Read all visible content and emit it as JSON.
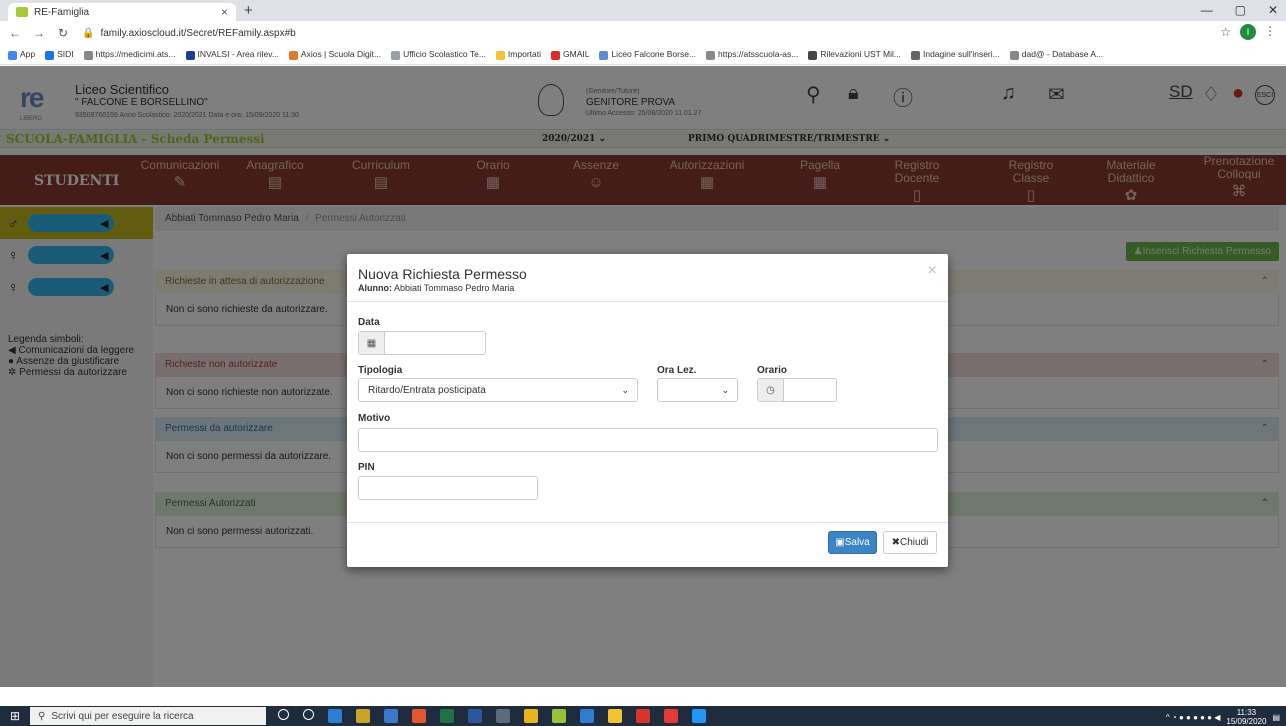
{
  "browser": {
    "tab_title": "RE-Famiglia",
    "tab_close": "×",
    "new_tab": "+",
    "url": "family.axioscloud.it/Secret/REFamily.aspx#b",
    "profile_initial": "I",
    "bookmarks": [
      {
        "label": "App",
        "color": "#4285f4"
      },
      {
        "label": "SIDI",
        "color": "#1a73e8"
      },
      {
        "label": "https://medicimi.ats...",
        "color": "#888"
      },
      {
        "label": "INVALSI - Area rilev...",
        "color": "#1e3f8c"
      },
      {
        "label": "Axios | Scuola Digit...",
        "color": "#e07a2a"
      },
      {
        "label": "Ufficio Scolastico Te...",
        "color": "#9aa0a6"
      },
      {
        "label": "Importati",
        "color": "#f4c430"
      },
      {
        "label": "GMAIL",
        "color": "#d93025"
      },
      {
        "label": "Liceo Falcone Borse...",
        "color": "#5a8fd0"
      },
      {
        "label": "https://atsscuola-as...",
        "color": "#888"
      },
      {
        "label": "Rilevazioni UST Mil...",
        "color": "#444"
      },
      {
        "label": "Indagine sull'inseri...",
        "color": "#666"
      },
      {
        "label": "dad@ - Database A...",
        "color": "#888"
      }
    ]
  },
  "header": {
    "logo": "re",
    "logo_sub": "LIBERO",
    "school_name": "Liceo Scientifico",
    "school_sub": "\" FALCONE E BORSELLINO\"",
    "school_info": "93508760159     Anno Scolastico: 2020/2021   Data e ora: 15/09/2020 11:30",
    "user_role": "(Genitore/Tutore)",
    "user_name": "GENITORE PROVA",
    "last_access": "Ultimo Accesso: 25/08/2020 11.01.27",
    "sd_label": "SD",
    "esci_label": "ESCI"
  },
  "subheader": {
    "title": "SCUOLA-FAMIGLIA - Scheda Permessi",
    "year": "2020/2021 ⌄",
    "period": "PRIMO QUADRIMESTRE/TRIMESTRE   ⌄"
  },
  "menu": {
    "studenti": "STUDENTI",
    "items": [
      {
        "label": "Comunicazioni",
        "icon": "✎"
      },
      {
        "label": "Anagrafico",
        "icon": "▤"
      },
      {
        "label": "Curriculum",
        "icon": "▤"
      },
      {
        "label": "Orario",
        "icon": "▦"
      },
      {
        "label": "Assenze",
        "icon": "☺"
      },
      {
        "label": "Autorizzazioni",
        "icon": "▦"
      },
      {
        "label": "Pagella",
        "icon": "▦"
      },
      {
        "label": "Registro Docente",
        "icon": "▯"
      },
      {
        "label": "Registro Classe",
        "icon": "▯"
      },
      {
        "label": "Materiale Didattico",
        "icon": "✿"
      },
      {
        "label": "Prenotazione Colloqui",
        "icon": "⌘"
      }
    ]
  },
  "sidebar": {
    "students": [
      {
        "gender": "♂",
        "megaphone": "📢"
      },
      {
        "gender": "♀",
        "megaphone": "📢"
      },
      {
        "gender": "♀",
        "megaphone": "📢"
      }
    ],
    "legend_title": "Legenda simboli:",
    "legend": [
      "Comunicazioni da leggere",
      "Assenze da giustificare",
      "Permessi da autorizzare"
    ]
  },
  "main": {
    "crumb_student": "Abbiati Tommaso Pedro Maria",
    "crumb_sep": "/",
    "crumb_current": "Permessi Autorizzati",
    "insert_button": "Inserisci Richiesta Permesso",
    "panels": [
      {
        "title": "Richieste in attesa di autorizzazione",
        "body": "Non ci sono richieste da autorizzare.",
        "bg": "#fcf8e3",
        "fg": "#8a6d3b"
      },
      {
        "title": "Richieste non autorizzate",
        "body": "Non ci sono richieste non autorizzate.",
        "bg": "#f2dede",
        "fg": "#a94442"
      },
      {
        "title": "Permessi da autorizzare",
        "body": "Non ci sono permessi da autorizzare.",
        "bg": "#d9edf7",
        "fg": "#31708f"
      },
      {
        "title": "Permessi Autorizzati",
        "body": "Non ci sono permessi autorizzati.",
        "bg": "#dff0d8",
        "fg": "#3c763d"
      }
    ]
  },
  "modal": {
    "title": "Nuova Richiesta Permesso",
    "student_label": "Alunno:",
    "student_name": "Abbiati Tommaso Pedro Maria",
    "close": "×",
    "data_label": "Data",
    "data_value": "",
    "tipologia_label": "Tipologia",
    "tipologia_value": "Ritardo/Entrata posticipata",
    "oralez_label": "Ora Lez.",
    "oralez_value": "",
    "orario_label": "Orario",
    "orario_value": "",
    "motivo_label": "Motivo",
    "motivo_value": "",
    "pin_label": "PIN",
    "pin_value": "",
    "salva": "Salva",
    "chiudi": "Chiudi"
  },
  "taskbar": {
    "search_placeholder": "Scrivi qui per eseguire la ricerca",
    "time": "11:33",
    "date": "15/09/2020",
    "app_colors": [
      "#ffffff",
      "#ffffff",
      "#2d7dd2",
      "#c9a227",
      "#3a78c8",
      "#e2572c",
      "#1f7244",
      "#2b579a",
      "#5c6b7a",
      "#e8b420",
      "#98c23c",
      "#2e7dd1",
      "#f4c430",
      "#d9342b",
      "#e53935",
      "#2196f3"
    ]
  }
}
